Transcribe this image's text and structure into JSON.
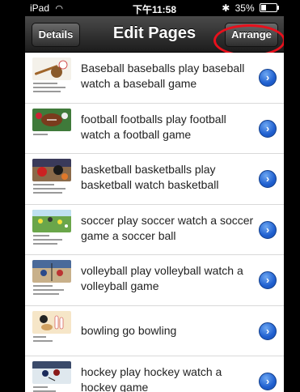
{
  "status_bar": {
    "carrier": "iPad",
    "time": "下午11:58",
    "battery": "35%",
    "battery_level": 0.35
  },
  "nav": {
    "title": "Edit Pages",
    "back_label": "Details",
    "arrange_label": "Arrange"
  },
  "rows": [
    {
      "text": "Baseball  baseballs  play baseball  watch a baseball game",
      "icon": "baseball-thumbnail"
    },
    {
      "text": "football  footballs  play football  watch a football game",
      "icon": "football-thumbnail"
    },
    {
      "text": "basketball  basketballs  play basketball  watch basketball",
      "icon": "basketball-thumbnail"
    },
    {
      "text": "soccer  play soccer  watch a soccer game  a soccer ball",
      "icon": "soccer-thumbnail"
    },
    {
      "text": "volleyball  play volleyball  watch a volleyball game",
      "icon": "volleyball-thumbnail"
    },
    {
      "text": "bowling  go bowling",
      "icon": "bowling-thumbnail"
    },
    {
      "text": "hockey  play hockey  watch a hockey game",
      "icon": "hockey-thumbnail"
    }
  ],
  "colors": {
    "highlight": "#e8101c",
    "disclosure": "#1f5fcf",
    "navbar": "#2a2a2a"
  }
}
